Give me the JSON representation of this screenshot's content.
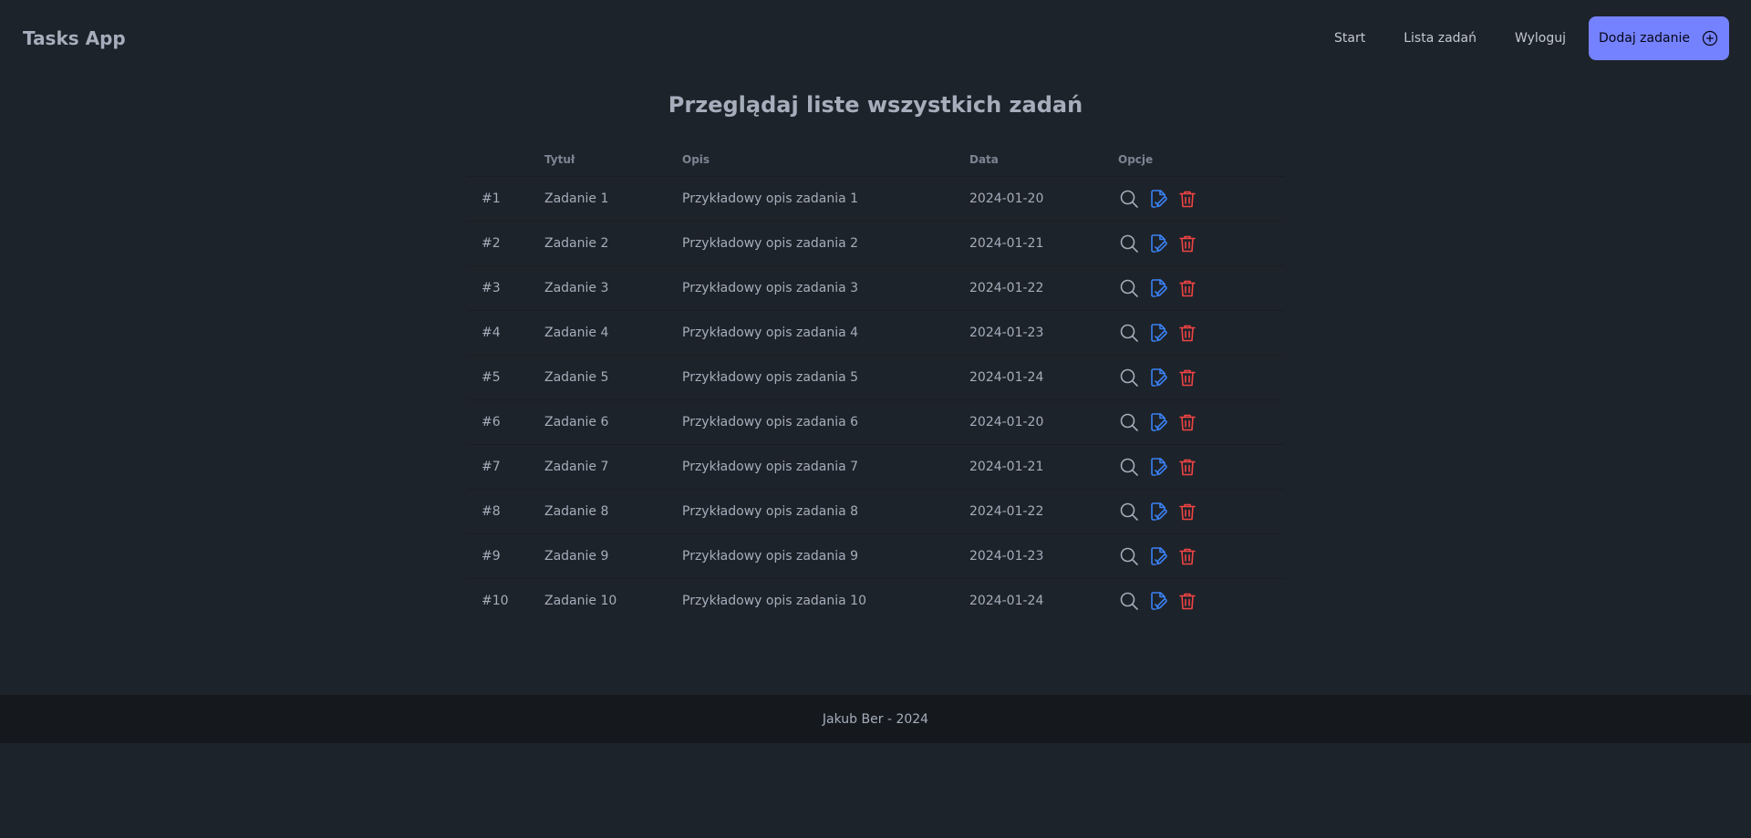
{
  "app": {
    "title": "Tasks App"
  },
  "nav": {
    "links": [
      "Start",
      "Lista zadań",
      "Wyloguj"
    ],
    "add_button": "Dodaj zadanie"
  },
  "page": {
    "title": "Przeglądaj liste wszystkich zadań"
  },
  "table": {
    "columns": [
      "",
      "Tytuł",
      "Opis",
      "Data",
      "Opcje"
    ],
    "rows": [
      {
        "id": "#1",
        "title": "Zadanie 1",
        "desc": "Przykładowy opis zadania 1",
        "date": "2024-01-20"
      },
      {
        "id": "#2",
        "title": "Zadanie 2",
        "desc": "Przykładowy opis zadania 2",
        "date": "2024-01-21"
      },
      {
        "id": "#3",
        "title": "Zadanie 3",
        "desc": "Przykładowy opis zadania 3",
        "date": "2024-01-22"
      },
      {
        "id": "#4",
        "title": "Zadanie 4",
        "desc": "Przykładowy opis zadania 4",
        "date": "2024-01-23"
      },
      {
        "id": "#5",
        "title": "Zadanie 5",
        "desc": "Przykładowy opis zadania 5",
        "date": "2024-01-24"
      },
      {
        "id": "#6",
        "title": "Zadanie 6",
        "desc": "Przykładowy opis zadania 6",
        "date": "2024-01-20"
      },
      {
        "id": "#7",
        "title": "Zadanie 7",
        "desc": "Przykładowy opis zadania 7",
        "date": "2024-01-21"
      },
      {
        "id": "#8",
        "title": "Zadanie 8",
        "desc": "Przykładowy opis zadania 8",
        "date": "2024-01-22"
      },
      {
        "id": "#9",
        "title": "Zadanie 9",
        "desc": "Przykładowy opis zadania 9",
        "date": "2024-01-23"
      },
      {
        "id": "#10",
        "title": "Zadanie 10",
        "desc": "Przykładowy opis zadania 10",
        "date": "2024-01-24"
      }
    ],
    "row_icons": [
      "search-icon",
      "edit-document-icon",
      "trash-icon"
    ]
  },
  "colors": {
    "accent": "#7582ff",
    "edit": "#3b82f6",
    "delete": "#ef4444"
  },
  "footer": {
    "text": "Jakub Ber - 2024"
  }
}
